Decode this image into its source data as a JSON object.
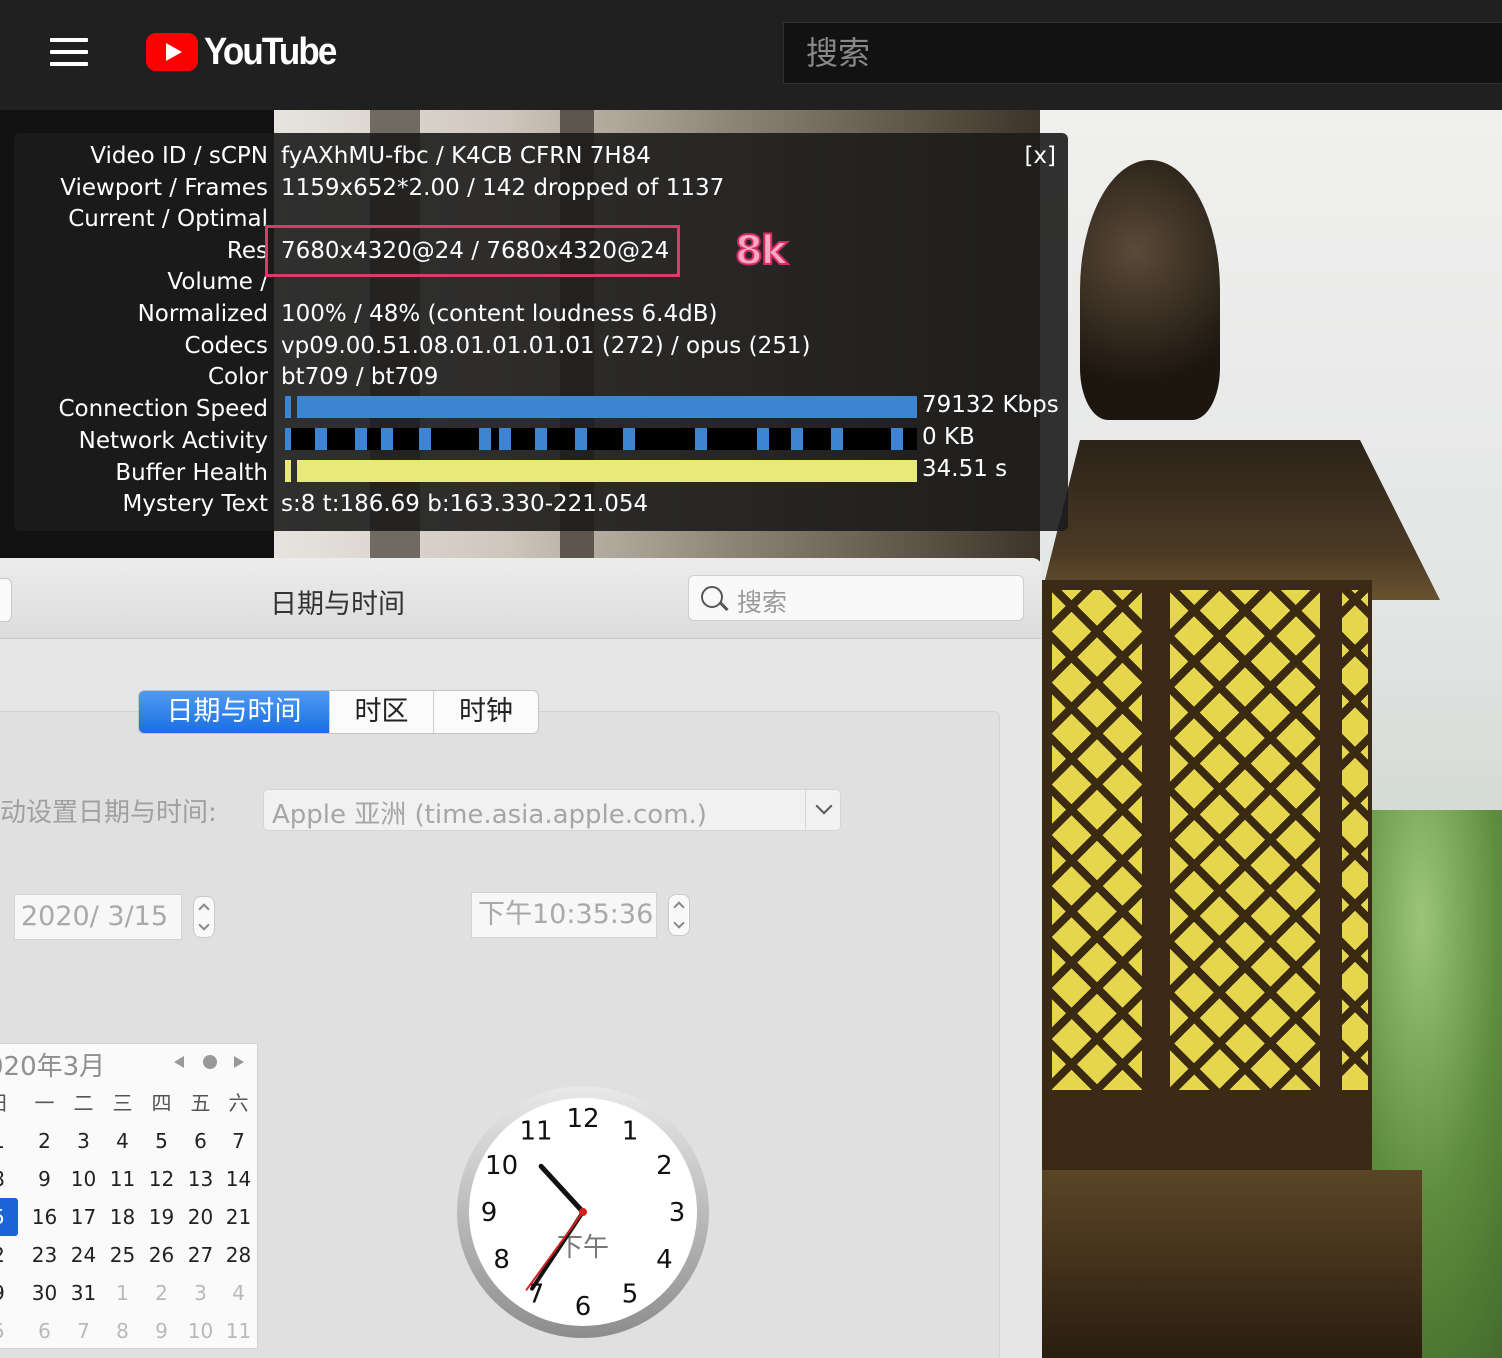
{
  "youtube": {
    "logo_text": "YouTube",
    "search_placeholder": "搜索"
  },
  "stats": {
    "close_label": "[x]",
    "rows": [
      {
        "label": "Video ID / sCPN",
        "value": "fyAXhMU-fbc / K4CB CFRN 7H84"
      },
      {
        "label": "Viewport / Frames",
        "value": "1159x652*2.00 / 142 dropped of 1137"
      },
      {
        "label": "Current / Optimal",
        "value": ""
      },
      {
        "label": "Res",
        "value": "7680x4320@24 / 7680x4320@24"
      },
      {
        "label": "Volume /",
        "value": ""
      },
      {
        "label": "Normalized",
        "value": "100% / 48% (content loudness 6.4dB)"
      },
      {
        "label": "Codecs",
        "value": "vp09.00.51.08.01.01.01.01 (272) / opus (251)"
      },
      {
        "label": "Color",
        "value": "bt709 / bt709"
      }
    ],
    "connection_speed": {
      "label": "Connection Speed",
      "value": "79132 Kbps",
      "fill": 1.0,
      "color": "#3d84d2"
    },
    "network_activity": {
      "label": "Network Activity",
      "value": "0 KB",
      "color": "#3d84d2"
    },
    "buffer_health": {
      "label": "Buffer Health",
      "value": "34.51 s",
      "fill": 1.0,
      "color": "#e7ea79"
    },
    "mystery_text": {
      "label": "Mystery Text",
      "value": "s:8 t:186.69 b:163.330-221.054"
    },
    "annotation": "8k"
  },
  "mac": {
    "title": "日期与时间",
    "search_placeholder": "搜索",
    "tabs": [
      {
        "label": "日期与时间",
        "active": true
      },
      {
        "label": "时区",
        "active": false
      },
      {
        "label": "时钟",
        "active": false
      }
    ],
    "auto_set_label": "动设置日期与时间:",
    "ntp_server": "Apple 亚洲 (time.asia.apple.com.)",
    "date_field": "2020/  3/15",
    "time_field": "下午10:35:36",
    "calendar": {
      "title": "020年3月",
      "weekdays": [
        "日",
        "一",
        "二",
        "三",
        "四",
        "五",
        "六"
      ],
      "weeks": [
        [
          "1",
          "2",
          "3",
          "4",
          "5",
          "6",
          "7"
        ],
        [
          "8",
          "9",
          "10",
          "11",
          "12",
          "13",
          "14"
        ],
        [
          "5",
          "16",
          "17",
          "18",
          "19",
          "20",
          "21"
        ],
        [
          "2",
          "23",
          "24",
          "25",
          "26",
          "27",
          "28"
        ],
        [
          "9",
          "30",
          "31",
          "1",
          "2",
          "3",
          "4"
        ],
        [
          "5",
          "6",
          "7",
          "8",
          "9",
          "10",
          "11"
        ]
      ],
      "muted_from_week": 4,
      "muted_from_index": 3,
      "selected": [
        2,
        0
      ]
    },
    "clock": {
      "numbers": [
        "12",
        "1",
        "2",
        "3",
        "4",
        "5",
        "6",
        "7",
        "8",
        "9",
        "10",
        "11"
      ],
      "meridiem": "下午",
      "hours": 10,
      "minutes": 35,
      "seconds": 36,
      "second_hand_color": "#d62020"
    }
  }
}
